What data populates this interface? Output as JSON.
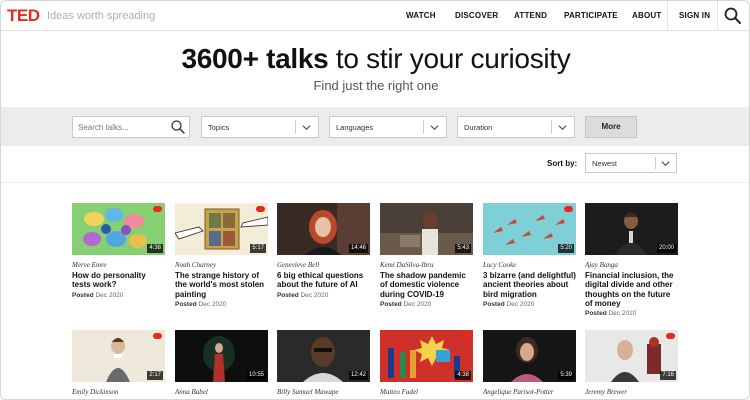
{
  "header": {
    "logo": "TED",
    "tagline": "Ideas worth spreading",
    "nav": [
      "WATCH",
      "DISCOVER",
      "ATTEND",
      "PARTICIPATE",
      "ABOUT"
    ],
    "signin": "SIGN IN",
    "search_icon": "search-icon"
  },
  "hero": {
    "title_bold": "3600+ talks",
    "title_rest": " to stir your curiosity",
    "subtitle": "Find just the right one"
  },
  "filters": {
    "search_placeholder": "Search talks...",
    "topics": "Topics",
    "languages": "Languages",
    "duration": "Duration",
    "more": "More"
  },
  "sort": {
    "label": "Sort by:",
    "value": "Newest"
  },
  "colors": {
    "brand": "#e62b1e",
    "filterbar": "#ececec"
  },
  "talks_row1": [
    {
      "speaker": "Merve Emre",
      "title": "How do personality tests work?",
      "posted_label": "Posted",
      "posted_date": "Dec 2020",
      "duration": "4:38"
    },
    {
      "speaker": "Noah Charney",
      "title": "The strange history of the world's most stolen painting",
      "posted_label": "Posted",
      "posted_date": "Dec 2020",
      "duration": "5:17"
    },
    {
      "speaker": "Genevieve Bell",
      "title": "6 big ethical questions about the future of AI",
      "posted_label": "Posted",
      "posted_date": "Dec 2020",
      "duration": "14:46"
    },
    {
      "speaker": "Kemi DaSilva-Ibru",
      "title": "The shadow pandemic of domestic violence during COVID-19",
      "posted_label": "Posted",
      "posted_date": "Dec 2020",
      "duration": "5:43"
    },
    {
      "speaker": "Lucy Cooke",
      "title": "3 bizarre (and delightful) ancient theories about bird migration",
      "posted_label": "Posted",
      "posted_date": "Dec 2020",
      "duration": "5:20"
    },
    {
      "speaker": "Ajay Banga",
      "title": "Financial inclusion, the digital divide and other thoughts on the future of money",
      "posted_label": "Posted",
      "posted_date": "Dec 2020",
      "duration": "20:00"
    }
  ],
  "talks_row2": [
    {
      "speaker": "Emily Dickinson",
      "duration": "2:17"
    },
    {
      "speaker": "Anna Babel",
      "duration": "10:55"
    },
    {
      "speaker": "Billy Samuel Mawape",
      "duration": "12:42"
    },
    {
      "speaker": "Matteo Fadel",
      "duration": "4:38"
    },
    {
      "speaker": "Angelique Parisot-Potter",
      "duration": "5:39"
    },
    {
      "speaker": "Jeremy Brewer",
      "duration": "7:16"
    }
  ]
}
